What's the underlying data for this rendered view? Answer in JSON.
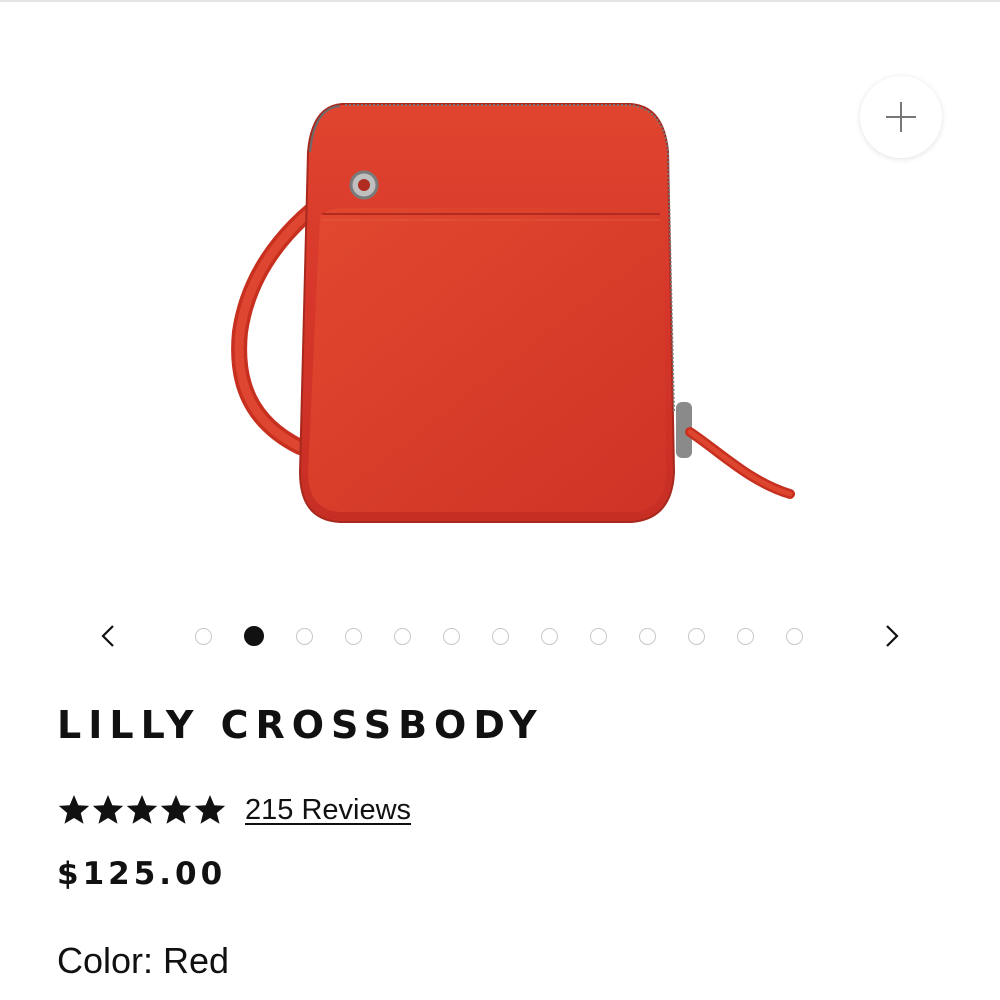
{
  "product": {
    "title": "LILLY CROSSBODY",
    "rating": 5,
    "rating_max": 5,
    "reviews_label": "215 Reviews",
    "price": "$125.00",
    "color_label": "Color: Red",
    "image_color": "#d7372a"
  },
  "gallery": {
    "slide_count": 13,
    "active_index": 1,
    "prev_icon": "chevron-left-icon",
    "next_icon": "chevron-right-icon",
    "zoom_icon": "plus-icon"
  },
  "colors": {
    "text": "#111111",
    "dot_inactive": "#c8c8c8",
    "dot_active": "#111111"
  }
}
